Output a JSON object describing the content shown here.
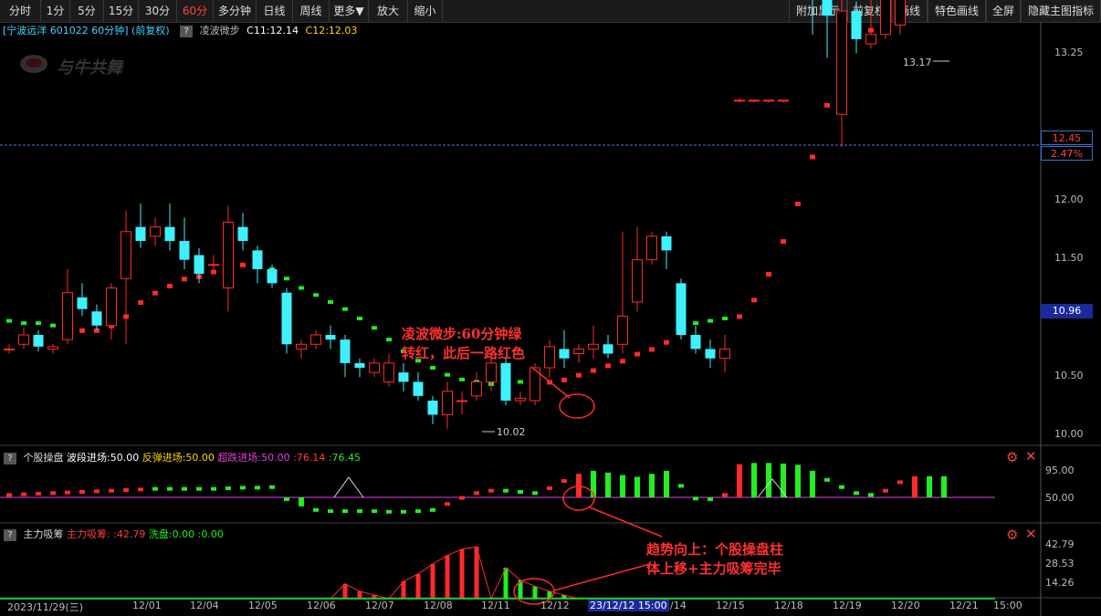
{
  "toolbar": {
    "left": [
      "分时",
      "1分",
      "5分",
      "15分",
      "30分",
      "60分",
      "多分钟",
      "日线",
      "周线",
      "更多▼",
      "放大",
      "缩小"
    ],
    "active": "60分",
    "right": [
      "附加显示",
      "前复权",
      "画线",
      "特色画线",
      "全屏",
      "隐藏主图指标"
    ]
  },
  "info": {
    "title": "[宁波远洋 601022 60分钟] (前复权)",
    "indicator": "凌波微步",
    "c11": "C11:12.14",
    "c12": "C12:12.03",
    "help": "?"
  },
  "watermark": "与牛共舞",
  "price_axis": {
    "ticks": [
      "13.25",
      "12.50",
      "12.00",
      "11.50",
      "10.50",
      "10.00"
    ],
    "current": "12.45",
    "change": "2.47%",
    "marker": "10.96",
    "high_label": "13.17",
    "low_label": "10.02"
  },
  "panel2": {
    "name": "个股操盘",
    "f1": "波段进场:50.00",
    "f2": "反弹进场:50.00",
    "f3": "超跌进场:50.00",
    "f4": ":76.14",
    "f5": ":76.45",
    "ticks": [
      "95.00",
      "50.00"
    ]
  },
  "panel3": {
    "name": "主力吸筹",
    "f1": "主力吸筹:",
    "f2": ":42.79",
    "f3": "洗盘:0.00",
    "f4": ":0.00",
    "ticks": [
      "42.79",
      "28.53",
      "14.26"
    ]
  },
  "xaxis": {
    "labels": [
      "2023/11/29(三)",
      "12/01",
      "12/04",
      "12/05",
      "12/06",
      "12/07",
      "12/08",
      "12/11",
      "12/12",
      "12/14",
      "12/15",
      "12/18",
      "12/19",
      "12/20",
      "12/21",
      "15:00"
    ],
    "cursor": "23/12/12 15:00"
  },
  "annotations": {
    "a1_line1": "凌波微步:60分钟绿",
    "a1_line2": "转红，此后一路红色",
    "a2_line1": "趋势向上：个股操盘柱",
    "a2_line2": "体上移+主力吸筹完毕"
  },
  "colors": {
    "up": "#ff2a2a",
    "down": "#3ff0ff",
    "green": "#22ee22",
    "axis": "#bbbbbb"
  },
  "chart_data": {
    "type": "candlestick",
    "price_min": 10.0,
    "price_max": 13.25,
    "candles": [
      [
        10.36,
        10.36,
        10.38,
        10.34
      ],
      [
        10.38,
        10.42,
        10.45,
        10.36
      ],
      [
        10.42,
        10.37,
        10.44,
        10.35
      ],
      [
        10.36,
        10.37,
        10.38,
        10.34
      ],
      [
        10.4,
        10.6,
        10.7,
        10.38
      ],
      [
        10.58,
        10.53,
        10.64,
        10.5
      ],
      [
        10.52,
        10.46,
        10.55,
        10.44
      ],
      [
        10.46,
        10.62,
        10.64,
        10.4
      ],
      [
        10.66,
        10.86,
        10.95,
        10.38
      ],
      [
        10.88,
        10.82,
        10.98,
        10.79
      ],
      [
        10.84,
        10.88,
        10.92,
        10.8
      ],
      [
        10.88,
        10.82,
        10.98,
        10.78
      ],
      [
        10.82,
        10.74,
        10.92,
        10.7
      ],
      [
        10.76,
        10.68,
        10.79,
        10.64
      ],
      [
        10.72,
        10.72,
        10.76,
        10.68
      ],
      [
        10.62,
        10.9,
        10.97,
        10.52
      ],
      [
        10.88,
        10.82,
        10.94,
        10.78
      ],
      [
        10.78,
        10.7,
        10.8,
        10.64
      ],
      [
        10.7,
        10.64,
        10.72,
        10.62
      ],
      [
        10.6,
        10.38,
        10.62,
        10.34
      ],
      [
        10.36,
        10.38,
        10.4,
        10.32
      ],
      [
        10.38,
        10.42,
        10.44,
        10.36
      ],
      [
        10.42,
        10.4,
        10.46,
        10.36
      ],
      [
        10.4,
        10.3,
        10.42,
        10.24
      ],
      [
        10.3,
        10.28,
        10.32,
        10.24
      ],
      [
        10.26,
        10.3,
        10.32,
        10.24
      ],
      [
        10.22,
        10.3,
        10.34,
        10.2
      ],
      [
        10.26,
        10.22,
        10.3,
        10.18
      ],
      [
        10.22,
        10.16,
        10.26,
        10.14
      ],
      [
        10.14,
        10.08,
        10.16,
        10.04
      ],
      [
        10.08,
        10.18,
        10.22,
        10.02
      ],
      [
        10.14,
        10.14,
        10.18,
        10.08
      ],
      [
        10.16,
        10.22,
        10.26,
        10.14
      ],
      [
        10.22,
        10.3,
        10.34,
        10.18
      ],
      [
        10.3,
        10.14,
        10.32,
        10.12
      ],
      [
        10.14,
        10.15,
        10.18,
        10.12
      ],
      [
        10.14,
        10.28,
        10.3,
        10.12
      ],
      [
        10.28,
        10.37,
        10.4,
        10.24
      ],
      [
        10.36,
        10.32,
        10.44,
        10.28
      ],
      [
        10.34,
        10.36,
        10.38,
        10.3
      ],
      [
        10.36,
        10.38,
        10.46,
        10.32
      ],
      [
        10.38,
        10.34,
        10.42,
        10.32
      ],
      [
        10.38,
        10.5,
        10.86,
        10.34
      ],
      [
        10.56,
        10.74,
        10.88,
        10.52
      ],
      [
        10.74,
        10.84,
        10.86,
        10.72
      ],
      [
        10.84,
        10.78,
        10.86,
        10.7
      ],
      [
        10.64,
        10.42,
        10.66,
        10.4
      ],
      [
        10.42,
        10.36,
        10.46,
        10.34
      ],
      [
        10.36,
        10.32,
        10.4,
        10.28
      ],
      [
        10.32,
        10.36,
        10.42,
        10.26
      ],
      [
        11.42,
        11.42,
        11.43,
        11.41
      ],
      [
        11.42,
        11.42,
        11.42,
        11.41
      ],
      [
        11.42,
        11.42,
        11.42,
        11.41
      ],
      [
        11.42,
        11.42,
        11.42,
        11.41
      ],
      [
        12.45,
        12.45,
        12.46,
        12.44
      ],
      [
        12.45,
        11.88,
        12.45,
        11.7
      ],
      [
        11.88,
        11.78,
        11.96,
        11.6
      ],
      [
        11.36,
        11.8,
        12.26,
        11.22
      ],
      [
        11.8,
        11.68,
        11.84,
        11.62
      ],
      [
        11.66,
        11.7,
        11.88,
        11.64
      ],
      [
        11.7,
        12.15,
        12.28,
        11.68
      ],
      [
        11.74,
        12.75,
        13.17,
        11.7
      ],
      [
        12.75,
        12.66,
        12.78,
        12.4
      ],
      [
        12.66,
        12.55,
        12.72,
        12.42
      ],
      [
        12.56,
        12.43,
        12.76,
        12.42
      ]
    ],
    "lingbo_line": [
      [
        10.48,
        "g"
      ],
      [
        10.47,
        "g"
      ],
      [
        10.47,
        "g"
      ],
      [
        10.46,
        "g"
      ],
      [
        10.45,
        "r"
      ],
      [
        10.44,
        "r"
      ],
      [
        10.44,
        "r"
      ],
      [
        10.46,
        "r"
      ],
      [
        10.5,
        "r"
      ],
      [
        10.56,
        "r"
      ],
      [
        10.6,
        "r"
      ],
      [
        10.63,
        "r"
      ],
      [
        10.66,
        "r"
      ],
      [
        10.67,
        "r"
      ],
      [
        10.69,
        "r"
      ],
      [
        10.7,
        "r"
      ],
      [
        10.72,
        "r"
      ],
      [
        10.71,
        "g"
      ],
      [
        10.7,
        "g"
      ],
      [
        10.66,
        "g"
      ],
      [
        10.62,
        "g"
      ],
      [
        10.59,
        "g"
      ],
      [
        10.56,
        "g"
      ],
      [
        10.53,
        "g"
      ],
      [
        10.49,
        "g"
      ],
      [
        10.45,
        "g"
      ],
      [
        10.4,
        "g"
      ],
      [
        10.35,
        "g"
      ],
      [
        10.31,
        "g"
      ],
      [
        10.28,
        "g"
      ],
      [
        10.25,
        "g"
      ],
      [
        10.23,
        "g"
      ],
      [
        10.22,
        "g"
      ],
      [
        10.21,
        "g"
      ],
      [
        10.22,
        "g"
      ],
      [
        10.22,
        "g"
      ],
      [
        10.22,
        "r"
      ],
      [
        10.22,
        "r"
      ],
      [
        10.23,
        "r"
      ],
      [
        10.25,
        "r"
      ],
      [
        10.27,
        "r"
      ],
      [
        10.29,
        "r"
      ],
      [
        10.31,
        "r"
      ],
      [
        10.34,
        "r"
      ],
      [
        10.36,
        "r"
      ],
      [
        10.39,
        "r"
      ],
      [
        10.43,
        "r"
      ],
      [
        10.47,
        "g"
      ],
      [
        10.48,
        "g"
      ],
      [
        10.49,
        "g"
      ],
      [
        10.5,
        "r"
      ],
      [
        10.57,
        "r"
      ],
      [
        10.68,
        "r"
      ],
      [
        10.82,
        "r"
      ],
      [
        10.98,
        "r"
      ],
      [
        11.18,
        "r"
      ],
      [
        11.4,
        "r"
      ],
      [
        11.62,
        "r"
      ],
      [
        11.7,
        "r"
      ],
      [
        11.72,
        "r"
      ],
      [
        11.75,
        "r"
      ],
      [
        11.82,
        "r"
      ],
      [
        11.9,
        "r"
      ],
      [
        12.0,
        "r"
      ],
      [
        12.08,
        "r"
      ]
    ],
    "panel2_bars": [
      [
        45,
        "r"
      ],
      [
        46,
        "r"
      ],
      [
        47,
        "r"
      ],
      [
        48,
        "r"
      ],
      [
        49,
        "r"
      ],
      [
        50,
        "r"
      ],
      [
        51,
        "r"
      ],
      [
        52,
        "r"
      ],
      [
        53,
        "r"
      ],
      [
        54,
        "r"
      ],
      [
        55,
        "g"
      ],
      [
        55,
        "g"
      ],
      [
        55,
        "g"
      ],
      [
        55,
        "g"
      ],
      [
        55,
        "g"
      ],
      [
        56,
        "g"
      ],
      [
        57,
        "g"
      ],
      [
        57,
        "g"
      ],
      [
        58,
        "g"
      ],
      [
        40,
        "g"
      ],
      [
        26,
        "g"
      ],
      [
        20,
        "g"
      ],
      [
        18,
        "g"
      ],
      [
        18,
        "g"
      ],
      [
        18,
        "g"
      ],
      [
        18,
        "g"
      ],
      [
        17,
        "g"
      ],
      [
        17,
        "g"
      ],
      [
        18,
        "g"
      ],
      [
        20,
        "g"
      ],
      [
        30,
        "r"
      ],
      [
        40,
        "r"
      ],
      [
        48,
        "r"
      ],
      [
        52,
        "r"
      ],
      [
        52,
        "g"
      ],
      [
        50,
        "g"
      ],
      [
        48,
        "g"
      ],
      [
        56,
        "r"
      ],
      [
        68,
        "r"
      ],
      [
        80,
        "r"
      ],
      [
        85,
        "g"
      ],
      [
        82,
        "g"
      ],
      [
        78,
        "g"
      ],
      [
        75,
        "g"
      ],
      [
        80,
        "g"
      ],
      [
        85,
        "g"
      ],
      [
        60,
        "g"
      ],
      [
        42,
        "g"
      ],
      [
        35,
        "g"
      ],
      [
        45,
        "r"
      ],
      [
        96,
        "r"
      ],
      [
        98,
        "g"
      ],
      [
        98,
        "g"
      ],
      [
        97,
        "g"
      ],
      [
        95,
        "g"
      ],
      [
        85,
        "g"
      ],
      [
        70,
        "g"
      ],
      [
        58,
        "g"
      ],
      [
        48,
        "g"
      ],
      [
        45,
        "g"
      ],
      [
        52,
        "r"
      ],
      [
        66,
        "r"
      ],
      [
        76,
        "r"
      ],
      [
        76,
        "g"
      ],
      [
        76,
        "g"
      ]
    ],
    "panel3_bars": [
      0,
      0,
      0,
      0,
      0,
      0,
      0,
      0,
      0,
      0,
      0,
      0,
      0,
      0,
      0,
      0,
      0,
      0,
      0,
      0,
      0,
      0,
      0,
      12,
      6,
      3,
      0,
      14,
      20,
      28,
      35,
      40,
      42,
      0,
      25,
      15,
      10,
      6,
      3,
      0,
      0,
      0,
      0,
      0,
      0,
      0,
      0,
      0,
      0,
      0,
      0,
      0,
      0,
      0,
      0,
      0,
      0,
      0,
      0,
      0,
      0,
      0,
      0,
      0,
      0
    ]
  }
}
